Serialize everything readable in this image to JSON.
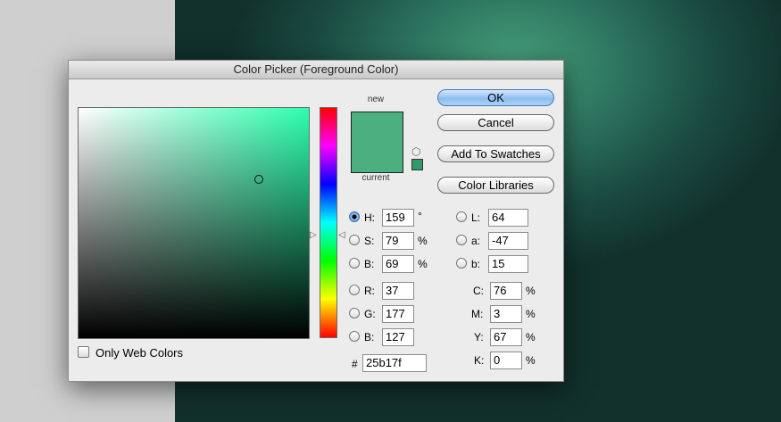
{
  "window": {
    "title": "Color Picker (Foreground Color)"
  },
  "preview": {
    "new_label": "new",
    "current_label": "current",
    "color": "#4caf7f"
  },
  "buttons": {
    "ok": "OK",
    "cancel": "Cancel",
    "add_to_swatches": "Add To Swatches",
    "color_libraries": "Color Libraries"
  },
  "hsb": {
    "h": {
      "label": "H:",
      "value": "159",
      "unit": "°",
      "selected": true
    },
    "s": {
      "label": "S:",
      "value": "79",
      "unit": "%"
    },
    "b": {
      "label": "B:",
      "value": "69",
      "unit": "%"
    }
  },
  "rgb": {
    "r": {
      "label": "R:",
      "value": "37"
    },
    "g": {
      "label": "G:",
      "value": "177"
    },
    "b": {
      "label": "B:",
      "value": "127"
    }
  },
  "lab": {
    "l": {
      "label": "L:",
      "value": "64"
    },
    "a": {
      "label": "a:",
      "value": "-47"
    },
    "b": {
      "label": "b:",
      "value": "15"
    }
  },
  "cmyk": {
    "c": {
      "label": "C:",
      "value": "76",
      "unit": "%"
    },
    "m": {
      "label": "M:",
      "value": "3",
      "unit": "%"
    },
    "y": {
      "label": "Y:",
      "value": "67",
      "unit": "%"
    },
    "k": {
      "label": "K:",
      "value": "0",
      "unit": "%"
    }
  },
  "hex": {
    "label": "#",
    "value": "25b17f"
  },
  "only_web_colors": {
    "label": "Only Web Colors",
    "checked": false
  }
}
